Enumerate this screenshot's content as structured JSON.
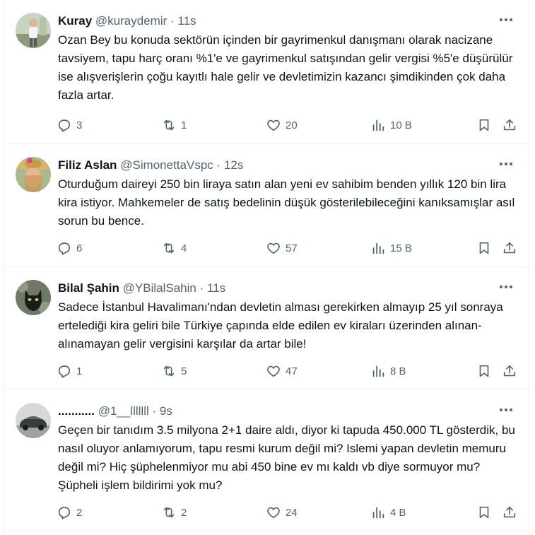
{
  "tweets": [
    {
      "name": "Kuray",
      "handle": "@kuraydemir",
      "separator": "·",
      "time": "11s",
      "text": "Ozan Bey bu konuda sektörün içinden bir gayrimenkul danışmanı olarak nacizane tavsiyem, tapu harç oranı %1'e ve gayrimenkul satışından gelir vergisi %5'e düşürülür ise alışverişlerin çoğu kayıtlı hale gelir ve devletimizin kazancı şimdikinden  çok daha fazla artar.",
      "replies": "3",
      "retweets": "1",
      "likes": "20",
      "views": "10 B"
    },
    {
      "name": "Filiz Aslan",
      "handle": "@SimonettaVspc",
      "separator": "·",
      "time": "12s",
      "text": "Oturduğum daireyi 250 bin liraya satın alan yeni ev sahibim benden yıllık 120 bin lira kira istiyor. Mahkemeler de satış bedelinin düşük gösterilebileceğini kanıksamışlar asıl sorun bu bence.",
      "replies": "6",
      "retweets": "4",
      "likes": "57",
      "views": "15 B"
    },
    {
      "name": "Bilal Şahin",
      "handle": "@YBilalSahin",
      "separator": "·",
      "time": "11s",
      "text": "Sadece İstanbul Havalimanı'ndan devletin alması gerekirken almayıp 25 yıl sonraya ertelediği kira geliri bile Türkiye çapında elde edilen ev kiraları üzerinden alınan-alınamayan gelir vergisini karşılar da artar bile!",
      "replies": "1",
      "retweets": "5",
      "likes": "47",
      "views": "8 B"
    },
    {
      "name": "...........",
      "handle": "@1__lllllll",
      "separator": "·",
      "time": "9s",
      "text": "Geçen bir tanıdım 3.5 milyona 2+1 daire aldı, diyor ki tapuda 450.000 TL gösterdik, bu nasıl oluyor anlamıyorum, tapu resmi kurum değil mi? Islemi yapan devletin memuru değil mi? Hiç şüphelenmiyor mu abi 450 bine ev mı kaldı vb diye sormuyor mu? Şüpheli işlem bildirimi yok mu?",
      "replies": "2",
      "retweets": "2",
      "likes": "24",
      "views": "4 B"
    }
  ],
  "icons": {
    "reply": "reply-icon",
    "retweet": "retweet-icon",
    "like": "heart-icon",
    "views": "views-icon",
    "bookmark": "bookmark-icon",
    "share": "share-icon",
    "more": "more-icon"
  },
  "colors": {
    "text": "#0f1419",
    "secondary": "#536471",
    "border": "#eff3f4"
  }
}
